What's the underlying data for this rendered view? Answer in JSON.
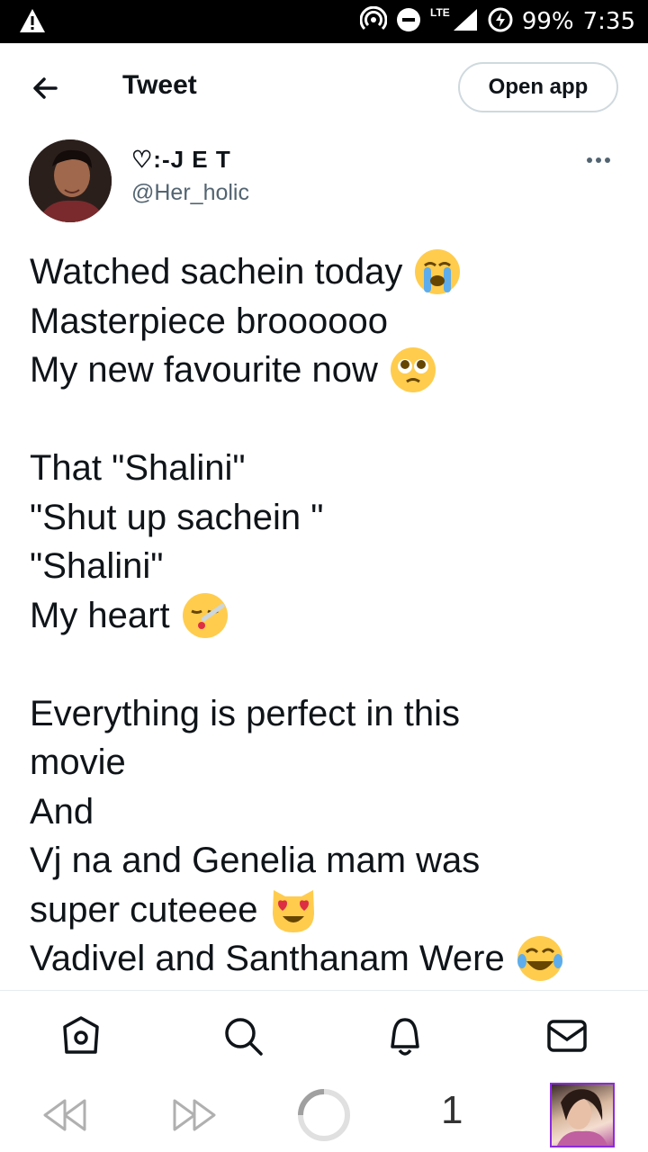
{
  "status_bar": {
    "battery": "99%",
    "time": "7:35",
    "network": "LTE",
    "icons": [
      "warning-icon",
      "hotspot-icon",
      "dnd-icon",
      "signal-icon",
      "battery-saver-icon"
    ]
  },
  "header": {
    "title": "Tweet",
    "open_app_label": "Open app"
  },
  "tweet": {
    "author_name": "♡:-J E T",
    "author_handle": "@Her_holic",
    "lines": [
      {
        "text": "Watched sachein today",
        "emoji": "loudly-crying-face"
      },
      {
        "text": "Masterpiece broooooo",
        "emoji": ""
      },
      {
        "text": "My new favourite now",
        "emoji": "pleading-eyes-face"
      },
      {
        "text": "",
        "emoji": ""
      },
      {
        "text": "That \"Shalini\"",
        "emoji": ""
      },
      {
        "text": "\"Shut up sachein \"",
        "emoji": ""
      },
      {
        "text": "\"Shalini\"",
        "emoji": ""
      },
      {
        "text": "My heart",
        "emoji": "face-with-thermometer"
      },
      {
        "text": "",
        "emoji": ""
      },
      {
        "text": "Everything is perfect in this",
        "emoji": ""
      },
      {
        "text": "movie",
        "emoji": ""
      },
      {
        "text": "And",
        "emoji": ""
      },
      {
        "text": "Vj na and Genelia mam was",
        "emoji": ""
      },
      {
        "text": "super cuteeee",
        "emoji": "heart-eyes-cat"
      },
      {
        "text": "Vadivel and Santhanam Were",
        "emoji": "tears-of-joy-face"
      }
    ]
  },
  "bottom_nav": [
    "home-icon",
    "search-icon",
    "notifications-icon",
    "messages-icon"
  ],
  "browser_bar": {
    "tab_count": "1"
  },
  "colors": {
    "text": "#0f1419",
    "secondary": "#536471",
    "border": "#cfd9de",
    "emoji_yellow": "#ffcc4d"
  }
}
